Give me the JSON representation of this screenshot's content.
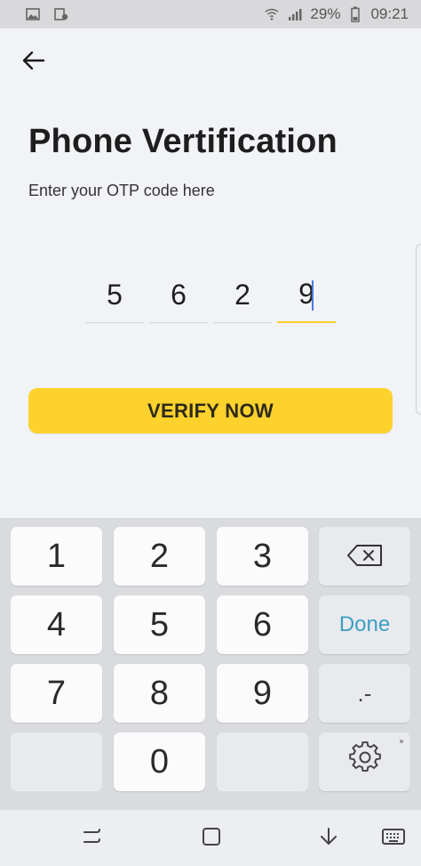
{
  "status_bar": {
    "battery_percent": "29%",
    "time": "09:21"
  },
  "page": {
    "title": "Phone Vertification",
    "subtitle": "Enter your OTP code here",
    "verify_label": "VERIFY NOW"
  },
  "otp": {
    "digits": [
      "5",
      "6",
      "2",
      "9"
    ],
    "active_index": 3
  },
  "keyboard": {
    "keys": [
      "1",
      "2",
      "3",
      "4",
      "5",
      "6",
      "7",
      "8",
      "9",
      "0"
    ],
    "done_label": "Done",
    "dot_dash_label": ".-"
  },
  "colors": {
    "accent": "#fdd22d",
    "done_text": "#3b9fc3",
    "caret": "#4a7bdc"
  },
  "icons": {
    "back": "arrow-left-icon",
    "backspace": "backspace-icon",
    "settings": "gear-icon"
  }
}
